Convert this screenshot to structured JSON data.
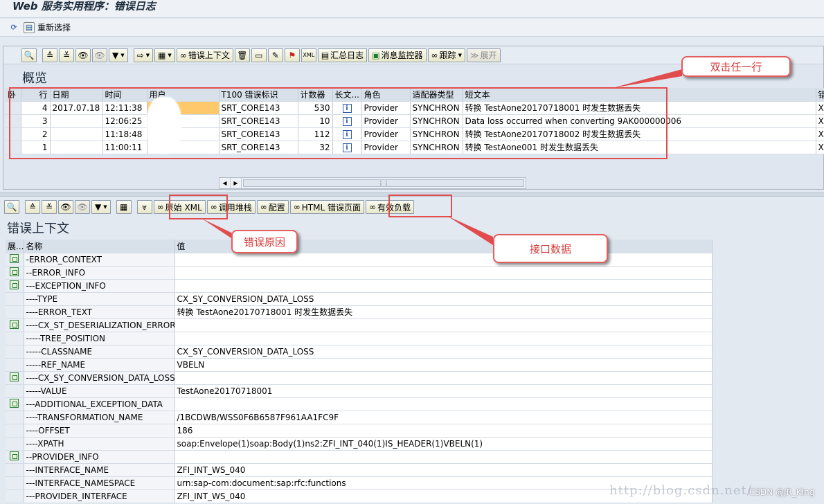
{
  "window": {
    "title": "Web 服务实用程序：错误日志"
  },
  "top_toolbar": {
    "reselect_label": "重新选择"
  },
  "overview": {
    "title": "概览",
    "toolbar": {
      "error_context": "错误上下文",
      "summary_log": "汇总日志",
      "message_monitor": "消息监控器",
      "trace": "跟踪",
      "expand": "展开",
      "xml_badge": "XML"
    },
    "columns": [
      "卧",
      "行",
      "日期",
      "时间",
      "用户",
      "T100 错误标识",
      "计数器",
      "长文...",
      "角色",
      "适配器类型",
      "短文本",
      "错"
    ],
    "rows": [
      {
        "row": "4",
        "date": "2017.07.18",
        "time": "12:11:38",
        "user": "",
        "t100": "SRT_CORE143",
        "counter": "530",
        "role": "Provider",
        "adapter": "SYNCHRON",
        "short_text": "转换 TestAone20170718001 时发生数据丢失",
        "extra": "XI"
      },
      {
        "row": "3",
        "date": "",
        "time": "12:06:25",
        "user": "",
        "t100": "SRT_CORE143",
        "counter": "10",
        "role": "Provider",
        "adapter": "SYNCHRON",
        "short_text": "Data loss occurred when converting 9AK000000006",
        "extra": "XI"
      },
      {
        "row": "2",
        "date": "",
        "time": "11:18:48",
        "user": "",
        "t100": "SRT_CORE143",
        "counter": "112",
        "role": "Provider",
        "adapter": "SYNCHRON",
        "short_text": "转换 TestAone20170718002 时发生数据丢失",
        "extra": "XI"
      },
      {
        "row": "1",
        "date": "",
        "time": "11:00:11",
        "user": "",
        "t100": "SRT_CORE143",
        "counter": "32",
        "role": "Provider",
        "adapter": "SYNCHRON",
        "short_text": "转换 TestAone001 时发生数据丢失",
        "extra": "XI"
      }
    ]
  },
  "context": {
    "title": "错误上下文",
    "toolbar": {
      "raw_xml": "原始 XML",
      "call_stack": "调用堆栈",
      "config": "配置",
      "html_error_page": "HTML 错误页面",
      "payload": "有效负载"
    },
    "columns": [
      "展...",
      "名称",
      "值"
    ],
    "rows": [
      {
        "expand": true,
        "name": "-ERROR_CONTEXT",
        "value": ""
      },
      {
        "expand": true,
        "name": "--ERROR_INFO",
        "value": ""
      },
      {
        "expand": true,
        "name": "---EXCEPTION_INFO",
        "value": ""
      },
      {
        "expand": false,
        "name": "----TYPE",
        "value": "CX_SY_CONVERSION_DATA_LOSS"
      },
      {
        "expand": false,
        "name": "----ERROR_TEXT",
        "value": "转换 TestAone20170718001 时发生数据丢失"
      },
      {
        "expand": true,
        "name": "----CX_ST_DESERIALIZATION_ERROR",
        "value": ""
      },
      {
        "expand": false,
        "name": "-----TREE_POSITION",
        "value": ""
      },
      {
        "expand": false,
        "name": "-----CLASSNAME",
        "value": "CX_SY_CONVERSION_DATA_LOSS"
      },
      {
        "expand": false,
        "name": "-----REF_NAME",
        "value": "VBELN"
      },
      {
        "expand": true,
        "name": "----CX_SY_CONVERSION_DATA_LOSS",
        "value": ""
      },
      {
        "expand": false,
        "name": "-----VALUE",
        "value": "TestAone20170718001"
      },
      {
        "expand": true,
        "name": "---ADDITIONAL_EXCEPTION_DATA",
        "value": ""
      },
      {
        "expand": false,
        "name": "----TRANSFORMATION_NAME",
        "value": "/1BCDWB/WSS0F6B6587F961AA1FC9F"
      },
      {
        "expand": false,
        "name": "----OFFSET",
        "value": "186"
      },
      {
        "expand": false,
        "name": "----XPATH",
        "value": "soap:Envelope(1)soap:Body(1)ns2:ZFI_INT_040(1)IS_HEADER(1)VBELN(1)"
      },
      {
        "expand": true,
        "name": "--PROVIDER_INFO",
        "value": ""
      },
      {
        "expand": false,
        "name": "---INTERFACE_NAME",
        "value": "ZFI_INT_WS_040"
      },
      {
        "expand": false,
        "name": "---INTERFACE_NAMESPACE",
        "value": "urn:sap-com:document:sap:rfc:functions"
      },
      {
        "expand": false,
        "name": "---PROVIDER_INTERFACE",
        "value": "ZFI_INT_WS_040"
      }
    ]
  },
  "annotations": {
    "double_click": "双击任一行",
    "error_cause": "错误原因",
    "interface_data": "接口数据",
    "accent_color": "#e24c4c"
  },
  "watermark": {
    "blog": "http://blog.csdn.net/",
    "csdn": "CSDN @JR_King"
  }
}
